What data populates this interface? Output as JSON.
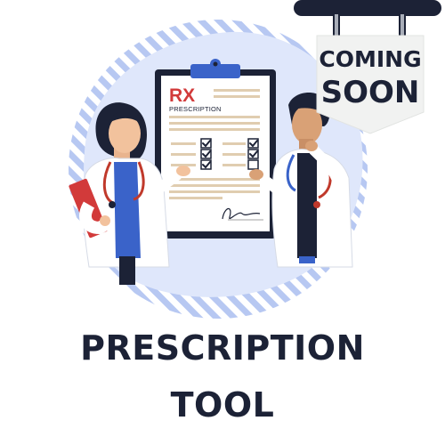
{
  "title": {
    "line1": "PRESCRIPTION",
    "line2": "TOOL"
  },
  "sign": {
    "line1": "COMING",
    "line2": "SOON"
  },
  "clipboard": {
    "heading": "RX",
    "subheading": "PRESCRIPTION"
  },
  "colors": {
    "title": "#1c2236",
    "circle_light": "#dfe7fb",
    "stripe": "#b7c8f2",
    "sign_bg": "#f1f2f1",
    "rx_red": "#d23a3a"
  },
  "icons": [
    "doctor-female-figure",
    "doctor-male-figure",
    "clipboard-icon",
    "checkbox-icon",
    "signature-icon",
    "hanging-sign-icon"
  ]
}
